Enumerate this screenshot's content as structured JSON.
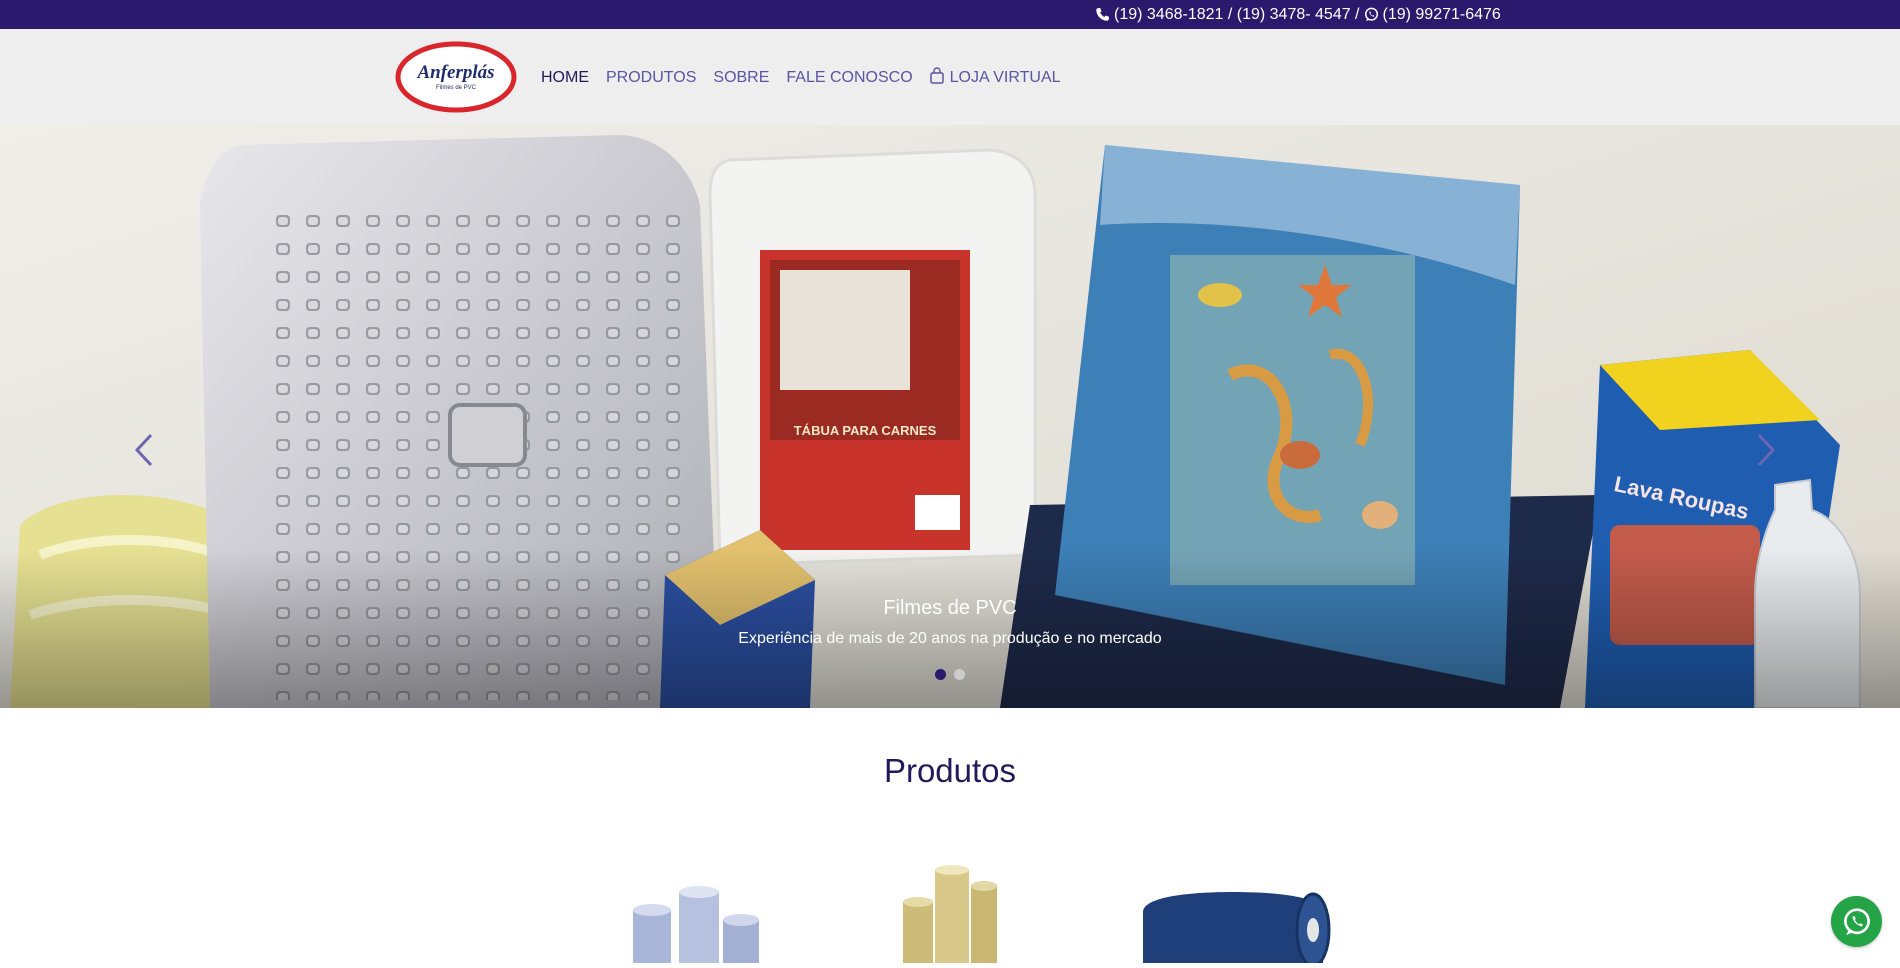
{
  "topbar": {
    "phones_text": "(19) 3468-1821 / (19) 3478- 4547 /",
    "whatsapp_text": "(19) 99271-6476"
  },
  "logo": {
    "brand": "Anferplás",
    "tagline": "Filmes de PVC"
  },
  "nav": {
    "items": [
      {
        "label": "HOME",
        "active": true
      },
      {
        "label": "PRODUTOS",
        "active": false
      },
      {
        "label": "SOBRE",
        "active": false
      },
      {
        "label": "FALE CONOSCO",
        "active": false
      },
      {
        "label": "LOJA VIRTUAL",
        "active": false,
        "icon": "shopping-bag-icon"
      }
    ]
  },
  "hero": {
    "title": "Filmes de PVC",
    "subtitle": "Experiência de mais de 20 anos na produção e no mercado",
    "slide_count": 2,
    "active_slide": 1,
    "scene_labels": {
      "cutting_board": "TÁBUA PARA CARNES",
      "detergent_box": "Lava Roupas"
    }
  },
  "products": {
    "title": "Produtos"
  },
  "colors": {
    "topbar_bg": "#2a1a6e",
    "nav_link": "#5b54a3",
    "nav_active": "#231a5c",
    "whatsapp_green": "#25a347",
    "logo_red": "#d8262c"
  }
}
